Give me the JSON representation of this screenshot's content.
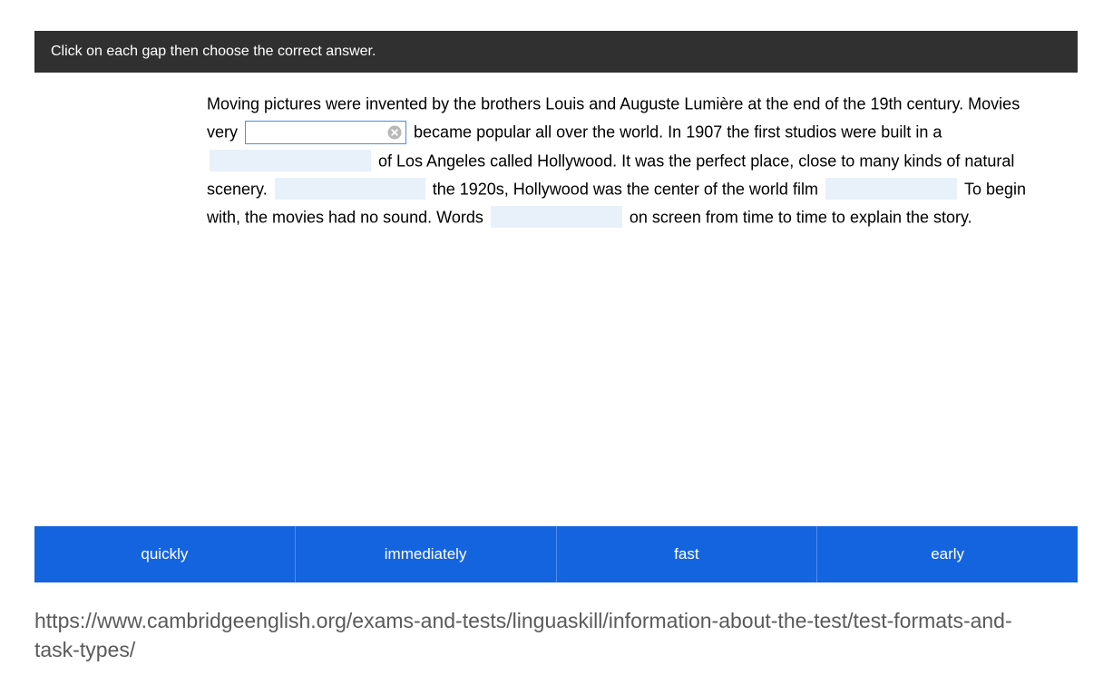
{
  "instruction": "Click on each gap then choose the correct answer.",
  "passage": {
    "seg1": "Moving pictures were invented by the brothers Louis and Auguste Lumière at the end of the 19th century. Movies very ",
    "seg2": " became popular all over the world. In 1907 the first studios were built in a ",
    "seg3": " of Los Angeles called Hollywood. It was the perfect place, close to many kinds of natural scenery. ",
    "seg4": " the 1920s, Hollywood was the center of the world film ",
    "seg5": " To begin with, the movies had no sound. Words ",
    "seg6": " on screen from time to time to explain the story."
  },
  "options": [
    "quickly",
    "immediately",
    "fast",
    "early"
  ],
  "footer_url": "https://www.cambridgeenglish.org/exams-and-tests/linguaskill/information-about-the-test/test-formats-and-task-types/"
}
